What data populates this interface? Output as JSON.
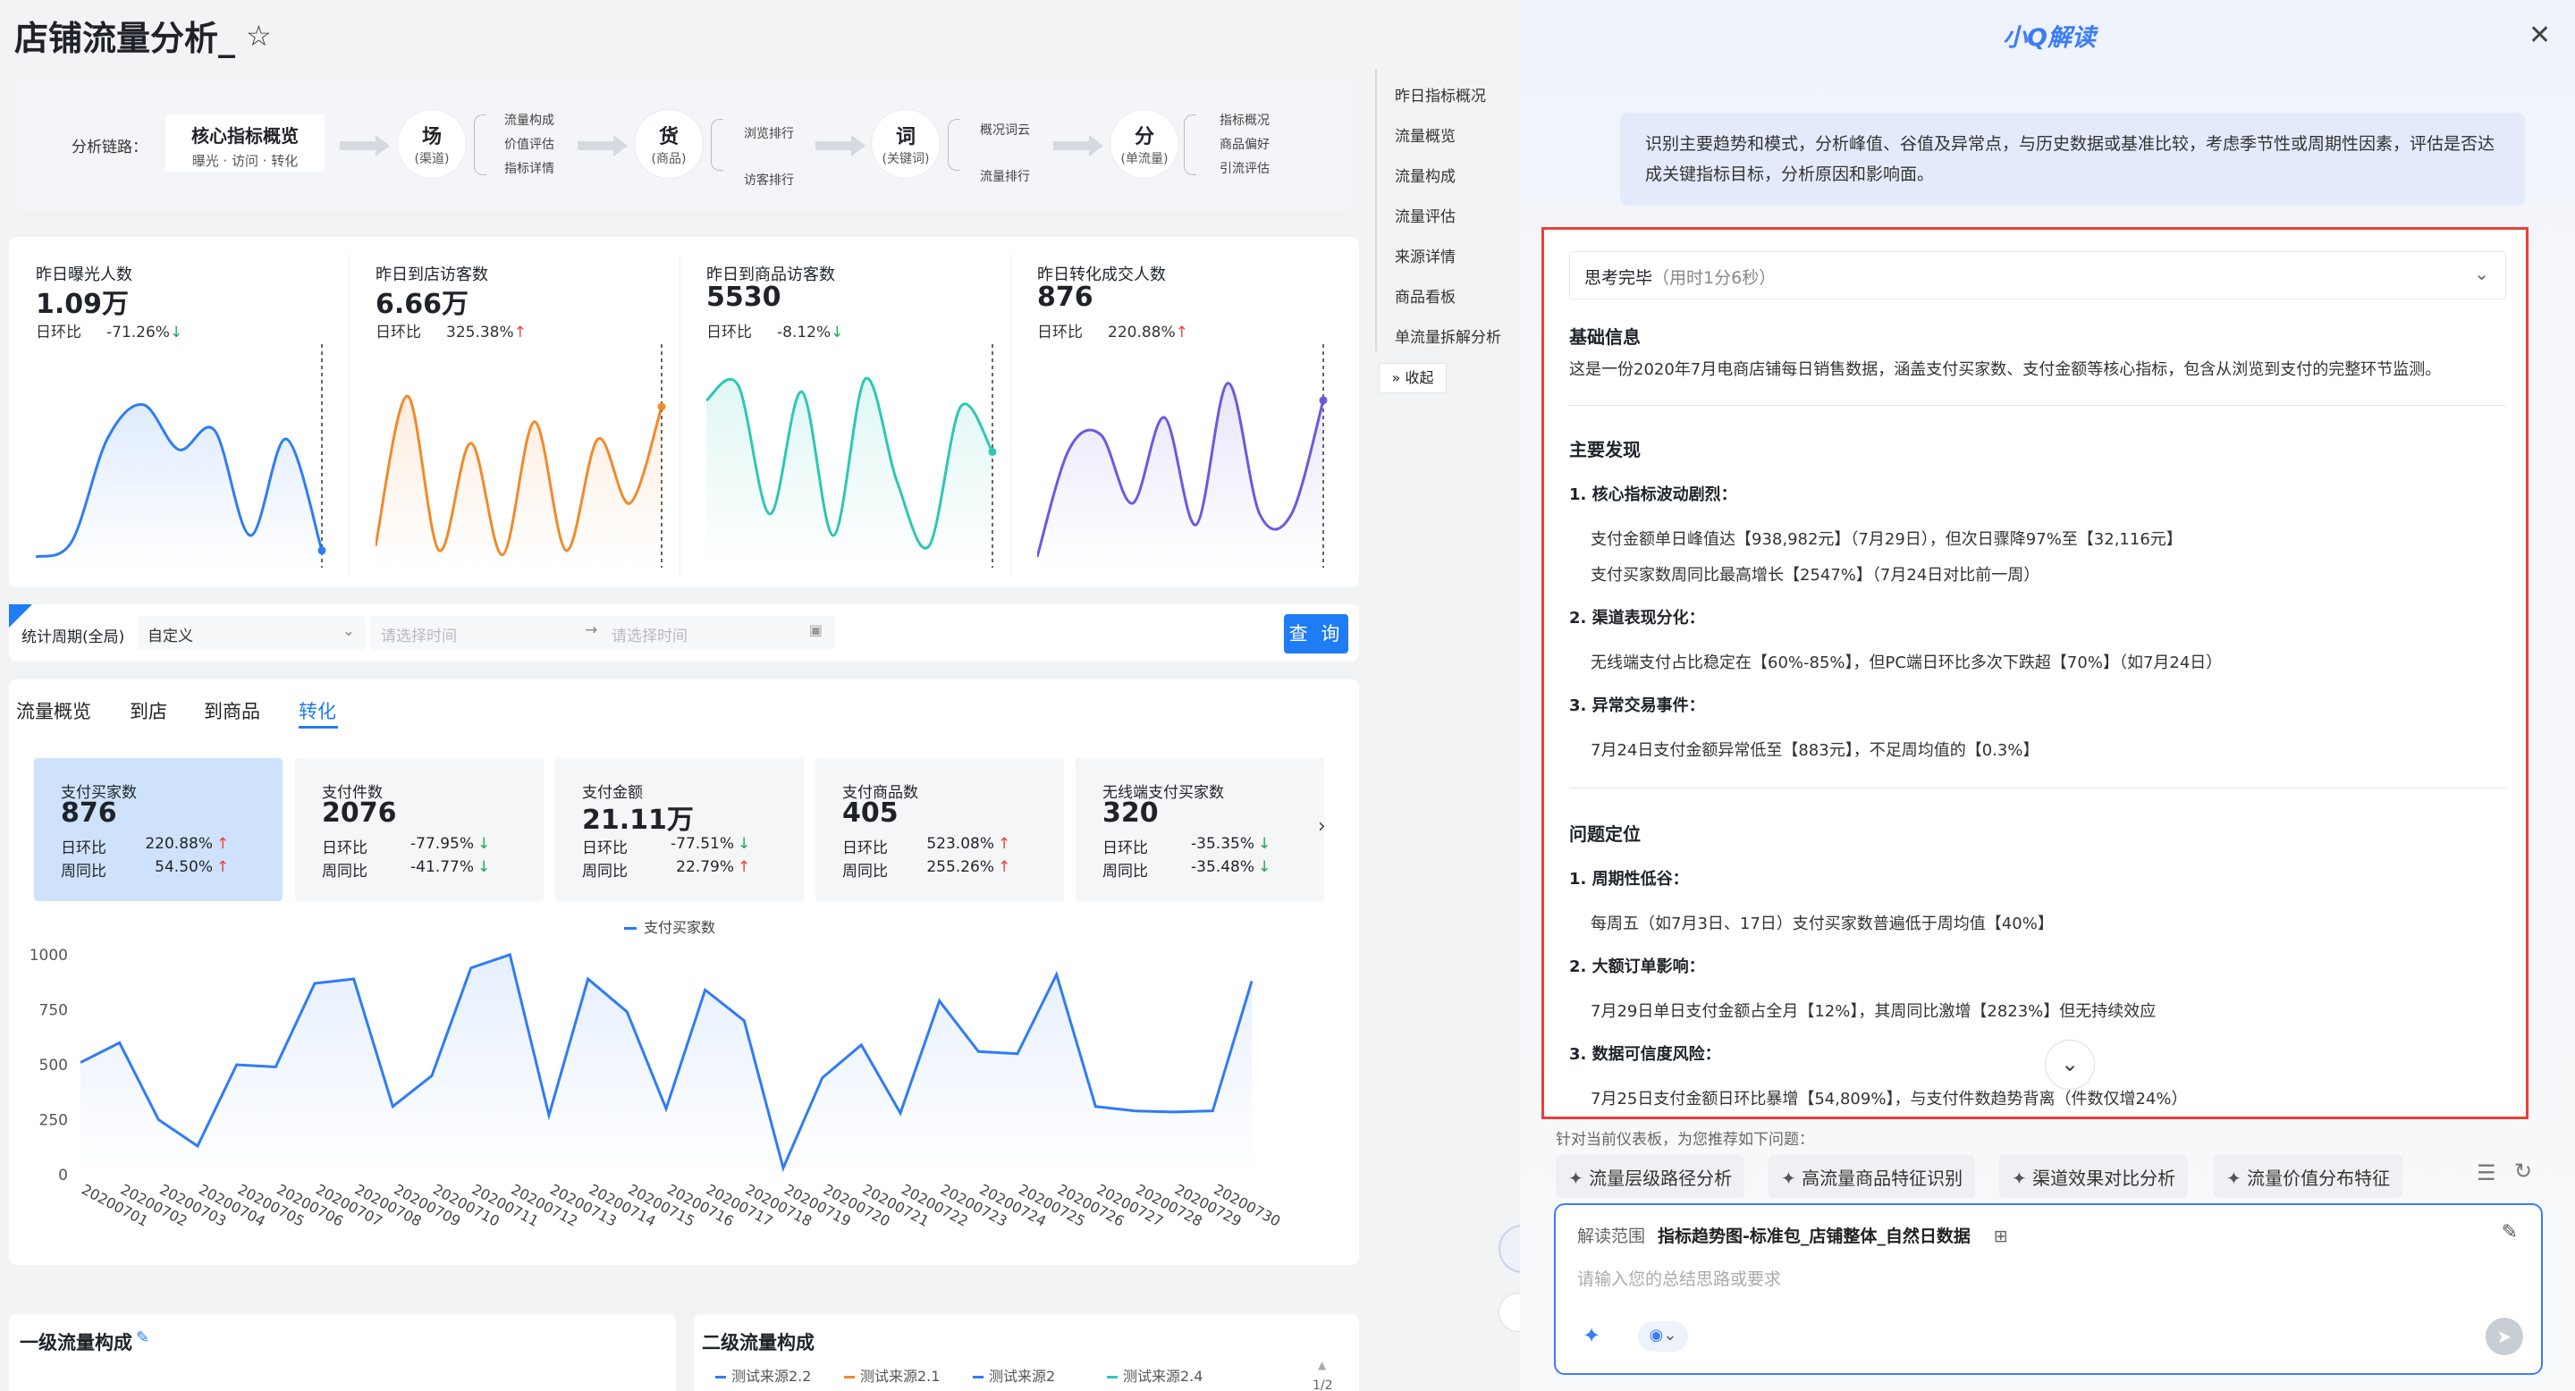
{
  "page": {
    "title": "店铺流量分析_"
  },
  "chain": {
    "label": "分析链路：",
    "core": {
      "title": "核心指标概览",
      "sub": "曝光 · 访问 · 转化"
    },
    "nodes": [
      {
        "title": "场",
        "sub": "(渠道)",
        "items": [
          "流量构成",
          "价值评估",
          "指标详情"
        ]
      },
      {
        "title": "货",
        "sub": "(商品)",
        "items": [
          "浏览排行",
          "访客排行"
        ]
      },
      {
        "title": "词",
        "sub": "(关键词)",
        "items": [
          "概况词云",
          "流量排行"
        ]
      },
      {
        "title": "分",
        "sub": "(单流量)",
        "items": [
          "指标概况",
          "商品偏好",
          "引流评估"
        ]
      }
    ]
  },
  "metrics": [
    {
      "label": "昨日曝光人数",
      "value": "1.09万",
      "cmp_label": "日环比",
      "cmp": "-71.26%",
      "dir": "down",
      "color": "#2f7cf6",
      "points": [
        5,
        12,
        60,
        76,
        55,
        64,
        15,
        60,
        8
      ]
    },
    {
      "label": "昨日到店访客数",
      "value": "6.66万",
      "cmp_label": "日环比",
      "cmp": "325.38%",
      "dir": "up",
      "color": "#f08a2c",
      "points": [
        10,
        80,
        8,
        58,
        6,
        68,
        8,
        60,
        30,
        75
      ]
    },
    {
      "label": "昨日到商品访客数",
      "value": "5530",
      "cmp_label": "日环比",
      "cmp": "-8.12%",
      "dir": "down",
      "color": "#2dc7b5",
      "points": [
        78,
        85,
        25,
        82,
        15,
        88,
        40,
        10,
        75,
        54
      ]
    },
    {
      "label": "昨日转化成交人数",
      "value": "876",
      "cmp_label": "日环比",
      "cmp": "220.88%",
      "dir": "up",
      "color": "#6a5ae0",
      "points": [
        5,
        55,
        62,
        30,
        70,
        20,
        86,
        25,
        25,
        78
      ]
    }
  ],
  "filter": {
    "label": "统计周期(全局)",
    "mode": "自定义",
    "start_ph": "请选择时间",
    "end_ph": "请选择时间",
    "query": "查 询"
  },
  "tabs": [
    "流量概览",
    "到店",
    "到商品",
    "转化"
  ],
  "kpis": [
    {
      "label": "支付买家数",
      "value": "876",
      "r1": "日环比",
      "v1": "220.88%",
      "d1": "up",
      "r2": "周同比",
      "v2": "54.50%",
      "d2": "up"
    },
    {
      "label": "支付件数",
      "value": "2076",
      "r1": "日环比",
      "v1": "-77.95%",
      "d1": "down",
      "r2": "周同比",
      "v2": "-41.77%",
      "d2": "down"
    },
    {
      "label": "支付金额",
      "value": "21.11万",
      "r1": "日环比",
      "v1": "-77.51%",
      "d1": "down",
      "r2": "周同比",
      "v2": "22.79%",
      "d2": "up"
    },
    {
      "label": "支付商品数",
      "value": "405",
      "r1": "日环比",
      "v1": "523.08%",
      "d1": "up",
      "r2": "周同比",
      "v2": "255.26%",
      "d2": "up"
    },
    {
      "label": "无线端支付买家数",
      "value": "320",
      "r1": "日环比",
      "v1": "-35.35%",
      "d1": "down",
      "r2": "周同比",
      "v2": "-35.48%",
      "d2": "down"
    }
  ],
  "chart_data": {
    "type": "area",
    "series": [
      {
        "name": "支付买家数",
        "values": [
          510,
          600,
          250,
          130,
          500,
          490,
          870,
          890,
          310,
          450,
          940,
          1000,
          270,
          890,
          740,
          300,
          840,
          700,
          30,
          440,
          590,
          280,
          790,
          560,
          550,
          910,
          310,
          290,
          285,
          290,
          880
        ]
      }
    ],
    "x": [
      "20200701",
      "20200702",
      "20200703",
      "20200704",
      "20200705",
      "20200706",
      "20200707",
      "20200708",
      "20200709",
      "20200710",
      "20200711",
      "20200712",
      "20200713",
      "20200714",
      "20200715",
      "20200716",
      "20200717",
      "20200718",
      "20200719",
      "20200720",
      "20200721",
      "20200722",
      "20200723",
      "20200724",
      "20200725",
      "20200726",
      "20200727",
      "20200728",
      "20200729",
      "20200730"
    ],
    "yticks": [
      "1000",
      "750",
      "500",
      "250",
      "0"
    ],
    "ylim": [
      0,
      1000
    ],
    "legend": "top"
  },
  "bottom": {
    "card1_title": "一级流量构成",
    "card2_title": "二级流量构成",
    "legend": [
      {
        "name": "测试来源2.2",
        "color": "#2f7cf6"
      },
      {
        "name": "测试来源2.1",
        "color": "#f08a2c"
      },
      {
        "name": "测试来源2",
        "color": "#2f7cf6"
      },
      {
        "name": "测试来源2.4",
        "color": "#2dc7b5"
      }
    ],
    "page": "1/2"
  },
  "nav": {
    "items": [
      "昨日指标概况",
      "流量概览",
      "流量构成",
      "流量评估",
      "来源详情",
      "商品看板",
      "单流量拆解分析"
    ],
    "collapse": "收起"
  },
  "panel": {
    "title": "小Q解读",
    "prompt": "识别主要趋势和模式，分析峰值、谷值及异常点，与历史数据或基准比较，考虑季节性或周期性因素，评估是否达成关键指标目标，分析原因和影响面。",
    "think": "思考完毕",
    "think_time": "（用时1分6秒）",
    "basic_title": "基础信息",
    "basic_text": "这是一份2020年7月电商店铺每日销售数据，涵盖支付买家数、支付金额等核心指标，包含从浏览到支付的完整环节监测。",
    "findings_title": "主要发现",
    "f1": "1. 核心指标波动剧烈：",
    "f1a": "支付金额单日峰值达【938,982元】（7月29日），但次日骤降97%至【32,116元】",
    "f1b": "支付买家数周同比最高增长【2547%】（7月24日对比前一周）",
    "f2": "2. 渠道表现分化：",
    "f2a": "无线端支付占比稳定在【60%-85%】，但PC端日环比多次下跌超【70%】（如7月24日）",
    "f3": "3. 异常交易事件：",
    "f3a": "7月24日支付金额异常低至【883元】，不足周均值的【0.3%】",
    "issue_title": "问题定位",
    "i1": "1. 周期性低谷：",
    "i1a": "每周五（如7月3日、17日）支付买家数普遍低于周均值【40%】",
    "i2": "2. 大额订单影响：",
    "i2a": "7月29日单日支付金额占全月【12%】，其周同比激增【2823%】但无持续效应",
    "i3": "3. 数据可信度风险：",
    "i3a": "7月25日支付金额日环比暴增【54,809%】，与支付件数趋势背离（件数仅增24%）",
    "suggest_hint": "针对当前仪表板，为您推荐如下问题：",
    "suggestions": [
      "流量层级路径分析",
      "高流量商品特征识别",
      "渠道效果对比分析",
      "流量价值分布特征"
    ],
    "scope_label": "解读范围",
    "scope_value": "指标趋势图-标准包_店铺整体_自然日数据",
    "input_ph": "请输入您的总结思路或要求"
  }
}
